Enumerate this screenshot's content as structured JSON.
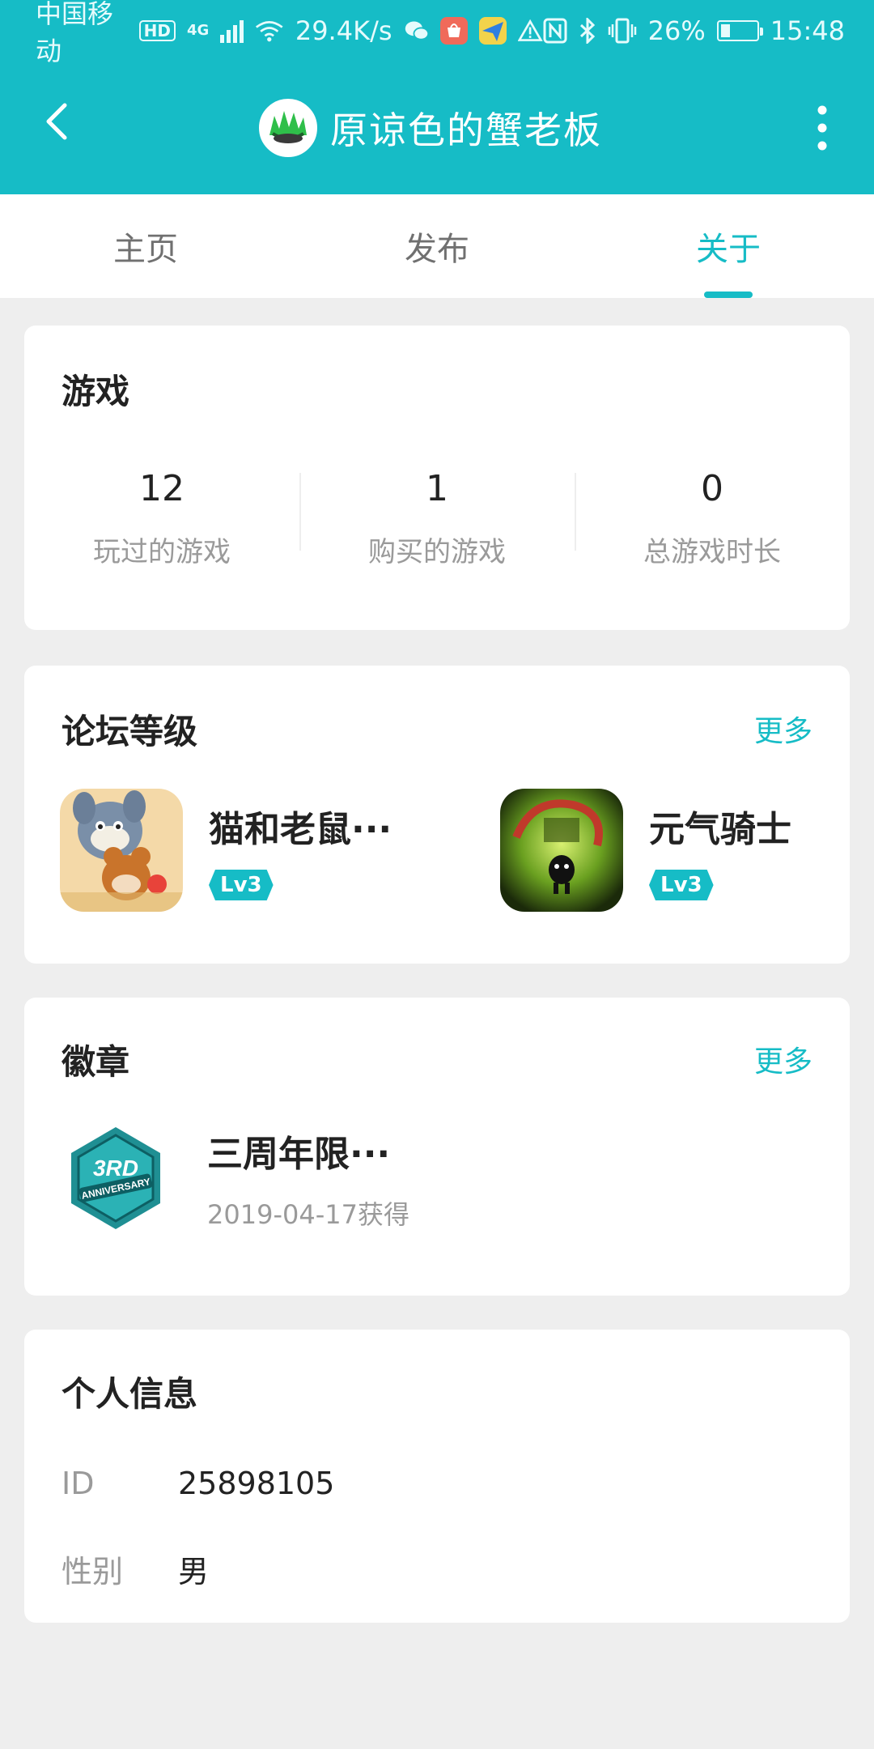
{
  "status_bar": {
    "carrier": "中国移动",
    "hd": "HD",
    "net_type": "4G",
    "speed": "29.4K/s",
    "battery": "26%",
    "battery_level": 0.26,
    "time": "15:48",
    "icons": [
      "signal-icon",
      "wifi-icon",
      "wechat-icon",
      "shopping-bag-icon",
      "paper-plane-icon",
      "warning-icon",
      "nfc-icon",
      "bluetooth-icon",
      "vibrate-icon",
      "battery-icon"
    ]
  },
  "header": {
    "title": "原谅色的蟹老板",
    "back_icon": "back-arrow-icon",
    "more_icon": "more-vertical-icon",
    "accent": "#16bcc6"
  },
  "tabs": [
    {
      "label": "主页",
      "active": false
    },
    {
      "label": "发布",
      "active": false
    },
    {
      "label": "关于",
      "active": true
    }
  ],
  "games_card": {
    "title": "游戏",
    "stats": [
      {
        "value": "12",
        "label": "玩过的游戏"
      },
      {
        "value": "1",
        "label": "购买的游戏"
      },
      {
        "value": "0",
        "label": "总游戏时长"
      }
    ]
  },
  "forum_card": {
    "title": "论坛等级",
    "more": "更多",
    "items": [
      {
        "name": "猫和老鼠···",
        "level": "Lv3"
      },
      {
        "name": "元气骑士",
        "level": "Lv3"
      }
    ]
  },
  "badges_card": {
    "title": "徽章",
    "more": "更多",
    "badge": {
      "name": "三周年限···",
      "date": "2019-04-17获得"
    }
  },
  "personal_card": {
    "title": "个人信息",
    "rows": [
      {
        "label": "ID",
        "value": "25898105"
      },
      {
        "label": "性别",
        "value": "男"
      }
    ]
  }
}
